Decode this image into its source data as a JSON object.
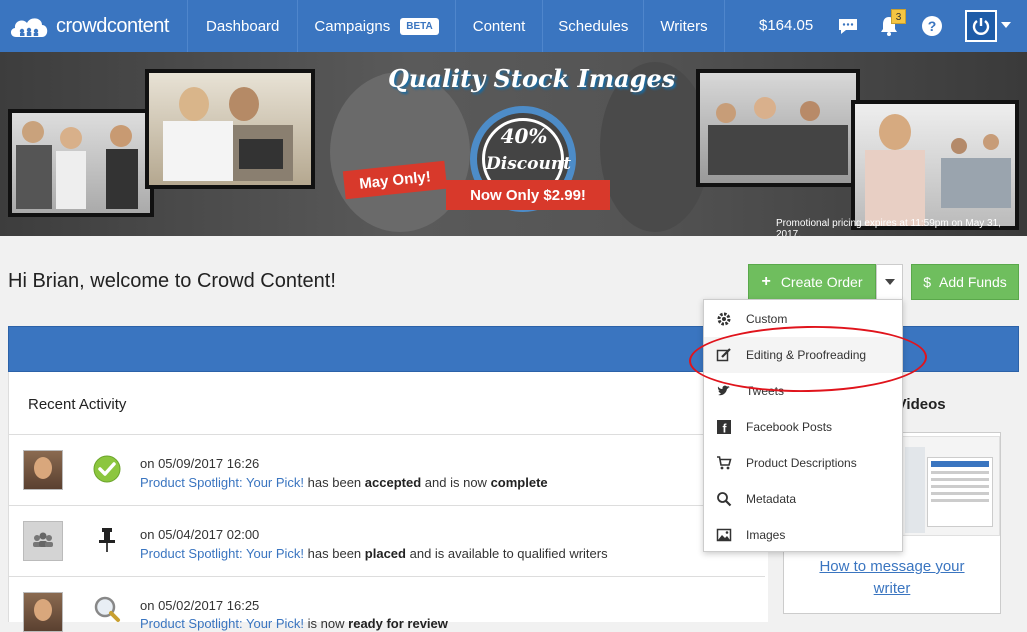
{
  "brand": {
    "name": "crowdcontent"
  },
  "nav": {
    "items": [
      "Dashboard",
      "Campaigns",
      "Content",
      "Schedules",
      "Writers"
    ],
    "beta_badge": "BETA",
    "balance": "$164.05",
    "notification_count": "3"
  },
  "banner": {
    "title": "Quality Stock Images",
    "percent": "40%",
    "discount": "Discount",
    "ribbon_left": "May Only!",
    "ribbon_right": "Now Only $2.99!",
    "promo_note": "Promotional pricing expires at 11:59pm on May 31, 2017."
  },
  "greeting": "Hi Brian, welcome to Crowd Content!",
  "actions": {
    "create_order": "Create Order",
    "add_funds": "Add Funds"
  },
  "dropdown": {
    "items": [
      {
        "label": "Custom",
        "icon": "gear-icon"
      },
      {
        "label": "Editing & Proofreading",
        "icon": "edit-icon"
      },
      {
        "label": "Tweets",
        "icon": "twitter-icon"
      },
      {
        "label": "Facebook Posts",
        "icon": "facebook-icon"
      },
      {
        "label": "Product Descriptions",
        "icon": "cart-icon"
      },
      {
        "label": "Metadata",
        "icon": "metadata-icon"
      },
      {
        "label": "Images",
        "icon": "image-icon"
      }
    ]
  },
  "recent_activity": {
    "title": "Recent Activity",
    "rows": [
      {
        "date": "on 05/09/2017 16:26",
        "link": "Product Spotlight: Your Pick!",
        "t1": "has been",
        "b1": "accepted",
        "t2": "and is now",
        "b2": "complete",
        "status_icon": "check-icon"
      },
      {
        "date": "on 05/04/2017 02:00",
        "link": "Product Spotlight: Your Pick!",
        "t1": "has been",
        "b1": "placed",
        "t2": "and is available to qualified writers",
        "b2": "",
        "status_icon": "pushpin-icon"
      },
      {
        "date": "on 05/02/2017 16:25",
        "link": "Product Spotlight: Your Pick!",
        "t1": "is now",
        "b1": "ready for review",
        "t2": "",
        "b2": "",
        "status_icon": "magnifier-icon"
      }
    ]
  },
  "sidebar": {
    "title_partial": "ent Videos",
    "video_link": "How to message your writer"
  },
  "colors": {
    "nav_blue": "#3a75c0",
    "green": "#6fbe5e",
    "ribbon_red": "#d8392b",
    "annotation_red": "#e0141c"
  }
}
